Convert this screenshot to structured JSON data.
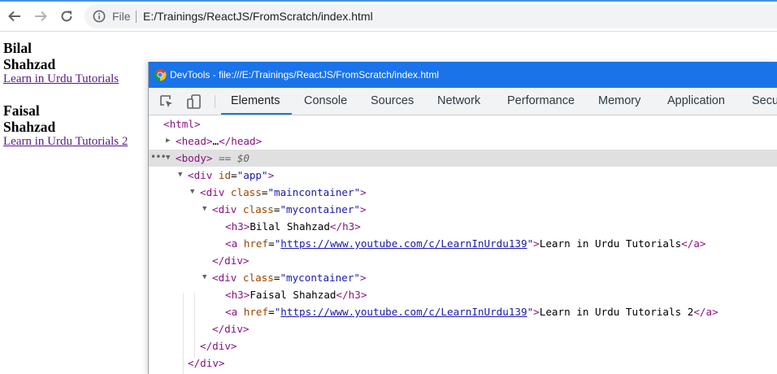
{
  "browser": {
    "scheme_label": "File",
    "url": "E:/Trainings/ReactJS/FromScratch/index.html",
    "accent_color": "#1a73e8"
  },
  "page": {
    "h3_1": "Bilal Shahzad",
    "link_1": "Learn in Urdu Tutorials",
    "h3_2": "Faisal Shahzad",
    "link_2": "Learn in Urdu Tutorials 2"
  },
  "devtools": {
    "window_title": "DevTools - file:///E:/Trainings/ReactJS/FromScratch/index.html",
    "tabs": [
      "Elements",
      "Console",
      "Sources",
      "Network",
      "Performance",
      "Memory",
      "Application",
      "Secu"
    ],
    "active_tab": "Elements",
    "dom": {
      "html_open": "<html>",
      "head_open": "<head>",
      "head_ellipsis": "…",
      "head_close": "</head>",
      "body_open": "<body>",
      "body_marker": " == $0",
      "div_app_open": "<div",
      "id_attr": " id",
      "app_val": "\"app\"",
      "div_close_gt": ">",
      "class_attr": " class",
      "maincontainer_val": "\"maincontainer\"",
      "mycontainer_val": "\"mycontainer\"",
      "h3_open": "<h3>",
      "h3_close": "</h3>",
      "h3_text_1": "Bilal Shahzad",
      "h3_text_2": "Faisal Shahzad",
      "a_open": "<a",
      "href_attr": " href",
      "href_val_q1": "\"",
      "href_url": "https://www.youtube.com/c/LearnInUrdu139",
      "href_val_q2": "\"",
      "a_text_1": "Learn in Urdu Tutorials",
      "a_text_2": "Learn in Urdu Tutorials 2",
      "a_close": "</a>",
      "div_close": "</div>",
      "equals": "="
    }
  }
}
